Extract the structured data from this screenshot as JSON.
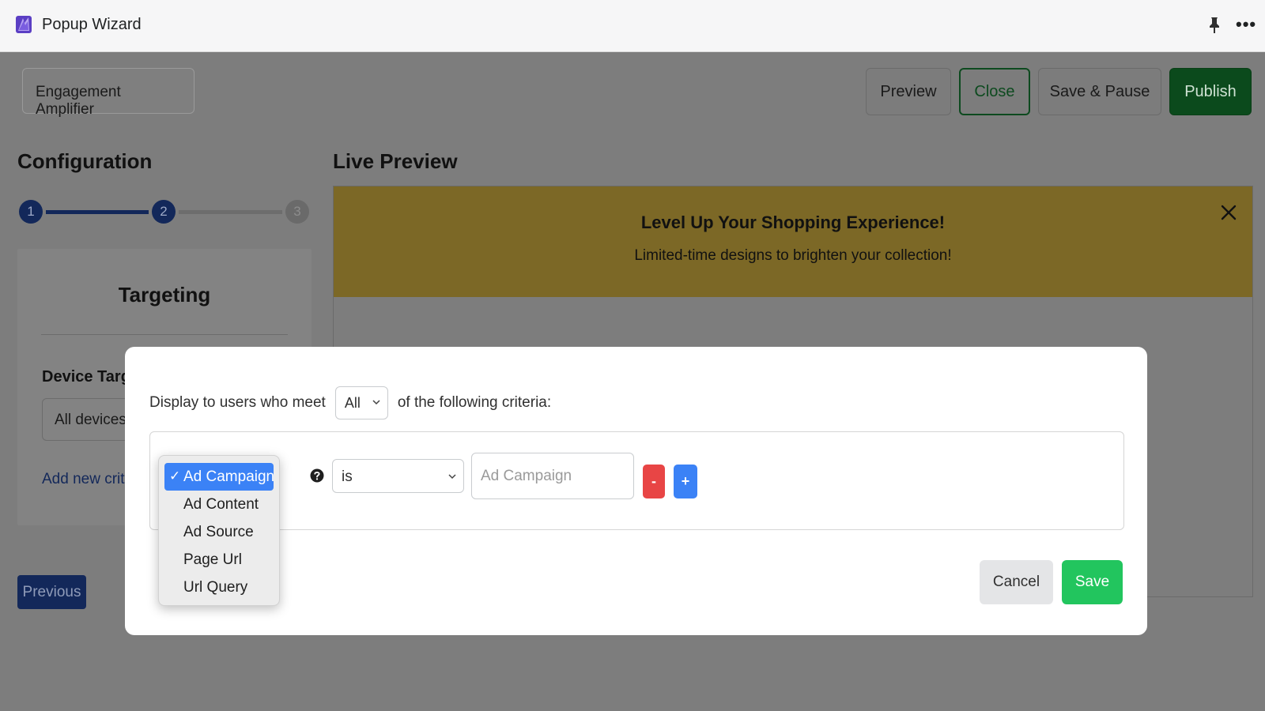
{
  "window": {
    "title": "Popup Wizard",
    "app_icon": "popup-wizard-logo",
    "pin_icon": "pin-icon",
    "more_icon": "more-horizontal-icon"
  },
  "header": {
    "campaign_name": "Engagement Amplifier",
    "buttons": {
      "preview": "Preview",
      "close": "Close",
      "save_pause": "Save & Pause",
      "publish": "Publish"
    }
  },
  "configuration": {
    "title": "Configuration",
    "steps": [
      "1",
      "2",
      "3"
    ],
    "current_step": 2,
    "targeting": {
      "title": "Targeting",
      "device_label": "Device Targe",
      "device_value": "All devices",
      "add_criteria": "Add new crite"
    },
    "previous_label": "Previous"
  },
  "live_preview": {
    "title": "Live Preview",
    "banner_title": "Level Up Your Shopping Experience!",
    "banner_subtitle": "Limited-time designs to brighten your collection!",
    "banner_color": "#ebc34a",
    "close_icon": "close-icon"
  },
  "modal": {
    "prefix": "Display to users who meet",
    "match_value": "All",
    "suffix": "of the following criteria:",
    "rule": {
      "field_options": [
        "Ad Campaign",
        "Ad Content",
        "Ad Source",
        "Page Url",
        "Url Query"
      ],
      "field_selected": "Ad Campaign",
      "help_icon": "question-circle-icon",
      "operator": "is",
      "value_placeholder": "Ad Campaign",
      "remove_label": "-",
      "add_label": "+"
    },
    "cancel_label": "Cancel",
    "save_label": "Save"
  },
  "colors": {
    "publish": "#14532d",
    "accent_blue": "#3b82f6",
    "save_green": "#22c55e",
    "remove_red": "#e84545",
    "overlay": "rgba(0,0,0,0.5)"
  }
}
